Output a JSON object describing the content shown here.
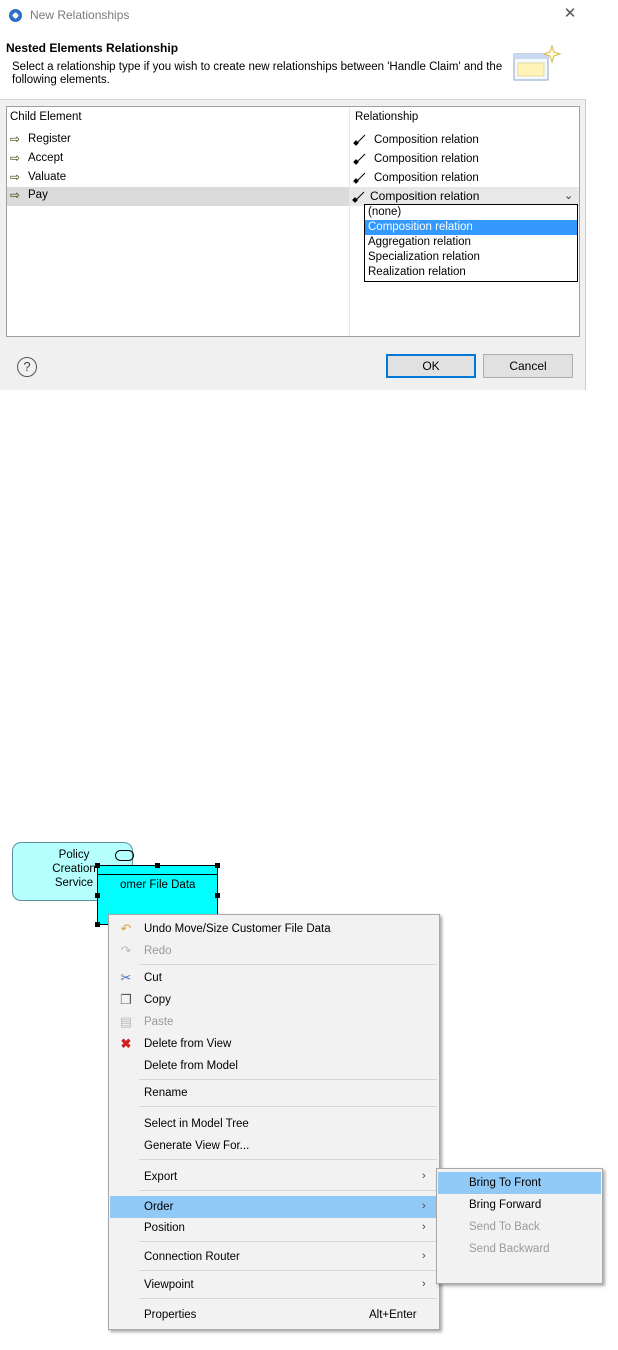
{
  "dialog": {
    "window_title": "New Relationships",
    "header_title": "Nested Elements Relationship",
    "header_description": "Select a relationship type if you wish to create new relationships between 'Handle Claim' and the following elements.",
    "columns": [
      "Child Element",
      "Relationship"
    ],
    "rows": [
      {
        "child": "Register",
        "relationship": "Composition relation"
      },
      {
        "child": "Accept",
        "relationship": "Composition relation"
      },
      {
        "child": "Valuate",
        "relationship": "Composition relation"
      },
      {
        "child": "Pay",
        "relationship": "Composition relation"
      }
    ],
    "selected_row": "Pay",
    "dropdown_options": [
      "(none)",
      "Composition relation",
      "Aggregation relation",
      "Specialization relation",
      "Realization relation"
    ],
    "dropdown_highlighted": "Composition relation",
    "help_symbol": "?",
    "ok_label": "OK",
    "cancel_label": "Cancel",
    "close_symbol": "✕"
  },
  "diagram": {
    "policy_node": {
      "line1": "Policy",
      "line2": "Creation",
      "line3": "Service"
    },
    "file_node": {
      "visible_label": "omer File Data"
    }
  },
  "context_menu": {
    "items": [
      {
        "label": "Undo Move/Size Customer File Data",
        "icon": "undo-icon",
        "enabled": true
      },
      {
        "label": "Redo",
        "icon": "redo-icon",
        "enabled": false
      },
      {
        "label": "Cut",
        "icon": "scissors-icon",
        "enabled": true
      },
      {
        "label": "Copy",
        "icon": "copy-icon",
        "enabled": true
      },
      {
        "label": "Paste",
        "icon": "paste-icon",
        "enabled": false
      },
      {
        "label": "Delete from View",
        "icon": "delete-icon",
        "enabled": true
      },
      {
        "label": "Delete from Model",
        "enabled": true
      },
      {
        "label": "Rename",
        "enabled": true
      },
      {
        "label": "Select in Model Tree",
        "enabled": true
      },
      {
        "label": "Generate View For...",
        "enabled": true
      },
      {
        "label": "Export",
        "submenu": true,
        "enabled": true
      },
      {
        "label": "Order",
        "submenu": true,
        "enabled": true,
        "highlighted": true
      },
      {
        "label": "Position",
        "submenu": true,
        "enabled": true
      },
      {
        "label": "Connection Router",
        "submenu": true,
        "enabled": true
      },
      {
        "label": "Viewpoint",
        "submenu": true,
        "enabled": true
      },
      {
        "label": "Properties",
        "accelerator": "Alt+Enter",
        "enabled": true
      }
    ],
    "submenu_arrow": "›",
    "order_submenu": [
      {
        "label": "Bring To Front",
        "enabled": true,
        "highlighted": true
      },
      {
        "label": "Bring Forward",
        "enabled": true
      },
      {
        "label": "Send To Back",
        "enabled": false
      },
      {
        "label": "Send Backward",
        "enabled": false
      }
    ]
  },
  "colors": {
    "selection_blue": "#3399ff",
    "menu_highlight": "#91c9f7",
    "file_node_fill": "#00ffff",
    "service_node_fill": "#b5ffff"
  }
}
